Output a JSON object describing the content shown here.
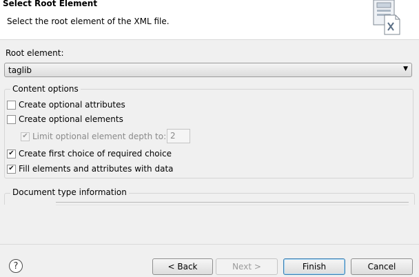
{
  "header": {
    "title": "Select Root Element",
    "description": "Select the root element of the XML file.",
    "icon": "xml-file-icon"
  },
  "root": {
    "label": "Root element:",
    "selected": "taglib"
  },
  "content_options": {
    "title": "Content options",
    "options": [
      {
        "label": "Create optional attributes",
        "checked": false,
        "enabled": true
      },
      {
        "label": "Create optional elements",
        "checked": false,
        "enabled": true
      },
      {
        "label": "Limit optional element depth to:",
        "checked": true,
        "enabled": false
      },
      {
        "label": "Create first choice of required choice",
        "checked": true,
        "enabled": true
      },
      {
        "label": "Fill elements and attributes with data",
        "checked": true,
        "enabled": true
      }
    ],
    "depth_value": "2"
  },
  "document_type": {
    "title": "Document type information"
  },
  "buttons": {
    "help": "?",
    "back": "< Back",
    "next": "Next >",
    "finish": "Finish",
    "cancel": "Cancel"
  }
}
